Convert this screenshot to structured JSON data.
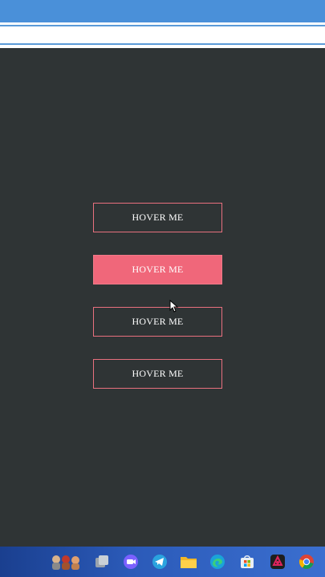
{
  "buttons": [
    {
      "label": "HOVER ME",
      "state": "normal"
    },
    {
      "label": "HOVER ME",
      "state": "hovered"
    },
    {
      "label": "HOVER ME",
      "state": "normal"
    },
    {
      "label": "HOVER ME",
      "state": "normal"
    }
  ],
  "colors": {
    "page_background": "#2f3435",
    "button_border": "#e8707e",
    "button_hover_fill": "#f0677a",
    "button_text": "#ffffff",
    "browser_top": "#4a90d9"
  },
  "taskbar": {
    "icons": [
      "people-icon",
      "task-view-icon",
      "chat-icon",
      "telegram-icon",
      "file-explorer-icon",
      "edge-icon",
      "store-icon",
      "app-icon",
      "chrome-icon"
    ]
  }
}
